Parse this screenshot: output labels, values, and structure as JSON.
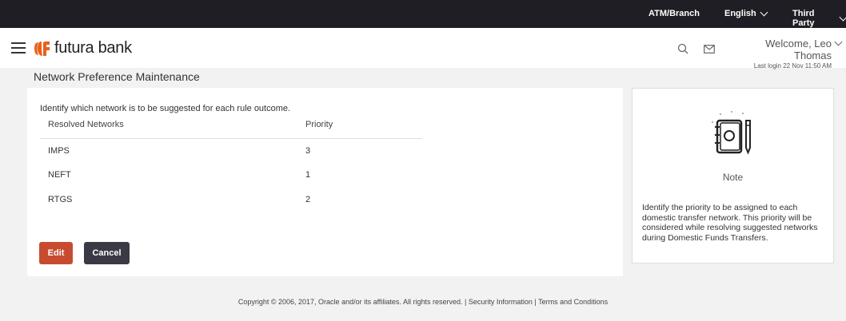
{
  "topbar": {
    "atm_branch": "ATM/Branch",
    "language": "English",
    "third_party": "Third Party"
  },
  "header": {
    "brand": "futura bank",
    "welcome": "Welcome, Leo Thomas",
    "last_login": "Last login 22 Nov 11:50 AM"
  },
  "page": {
    "title": "Network Preference Maintenance",
    "description": "Identify which network is to be suggested for each rule outcome.",
    "columns": [
      "Resolved Networks",
      "Priority"
    ],
    "rows": [
      {
        "network": "IMPS",
        "priority": "3"
      },
      {
        "network": "NEFT",
        "priority": "1"
      },
      {
        "network": "RTGS",
        "priority": "2"
      }
    ],
    "edit_label": "Edit",
    "cancel_label": "Cancel"
  },
  "note": {
    "title": "Note",
    "text": "Identify the priority to be assigned to each domestic transfer network. This priority will be considered while resolving suggested networks during Domestic Funds Transfers."
  },
  "footer": {
    "copyright": "Copyright © 2006, 2017, Oracle and/or its affiliates. All rights reserved.",
    "separator": "|",
    "security": "Security Information",
    "terms": "Terms and Conditions"
  },
  "colors": {
    "topbar_bg": "#1e1e24",
    "brand_orange": "#e8601c",
    "edit_button": "#c84b31",
    "cancel_button": "#3a3a46"
  },
  "icons": [
    "hamburger-menu-icon",
    "futura-logo-icon",
    "search-icon",
    "mail-icon",
    "chevron-down-icon",
    "notebook-pen-icon"
  ]
}
